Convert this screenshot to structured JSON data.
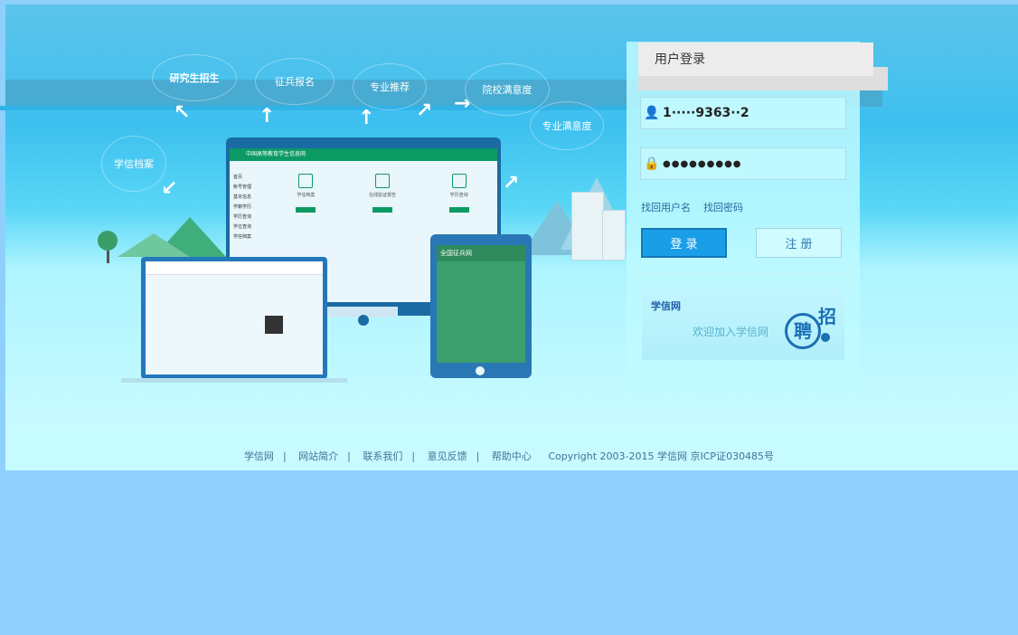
{
  "hero": {
    "bubbles": [
      "研究生招生",
      "征兵报名",
      "专业推荐",
      "院校满意度",
      "专业满意度",
      "学信档案"
    ]
  },
  "monitor": {
    "header_text": "中国高等教育学生信息网",
    "sidebar": [
      "首页",
      "帐号管理",
      "基本信息",
      "学籍学历",
      "学历查询",
      "学位查询",
      "学信档案"
    ],
    "cards": [
      {
        "title": "学信档案"
      },
      {
        "title": "在线验证报告"
      },
      {
        "title": "学历查询"
      }
    ]
  },
  "tablet": {
    "title": "全国征兵网"
  },
  "login": {
    "title": "用户登录",
    "username_value": "1·····9363··2",
    "password_value": "●●●●●●●●●",
    "find_username": "找回用户名",
    "find_password": "找回密码",
    "login_button": "登 录",
    "register_button": "注 册",
    "banner_brand": "学信网",
    "banner_welcome": "欢迎加入学信网",
    "banner_hire": "招",
    "banner_pin": "聘"
  },
  "footer": {
    "links": [
      "学信网",
      "网站简介",
      "联系我们",
      "意见反馈",
      "帮助中心"
    ],
    "copyright": "Copyright 2003-2015 学信网 京ICP证030485号"
  }
}
